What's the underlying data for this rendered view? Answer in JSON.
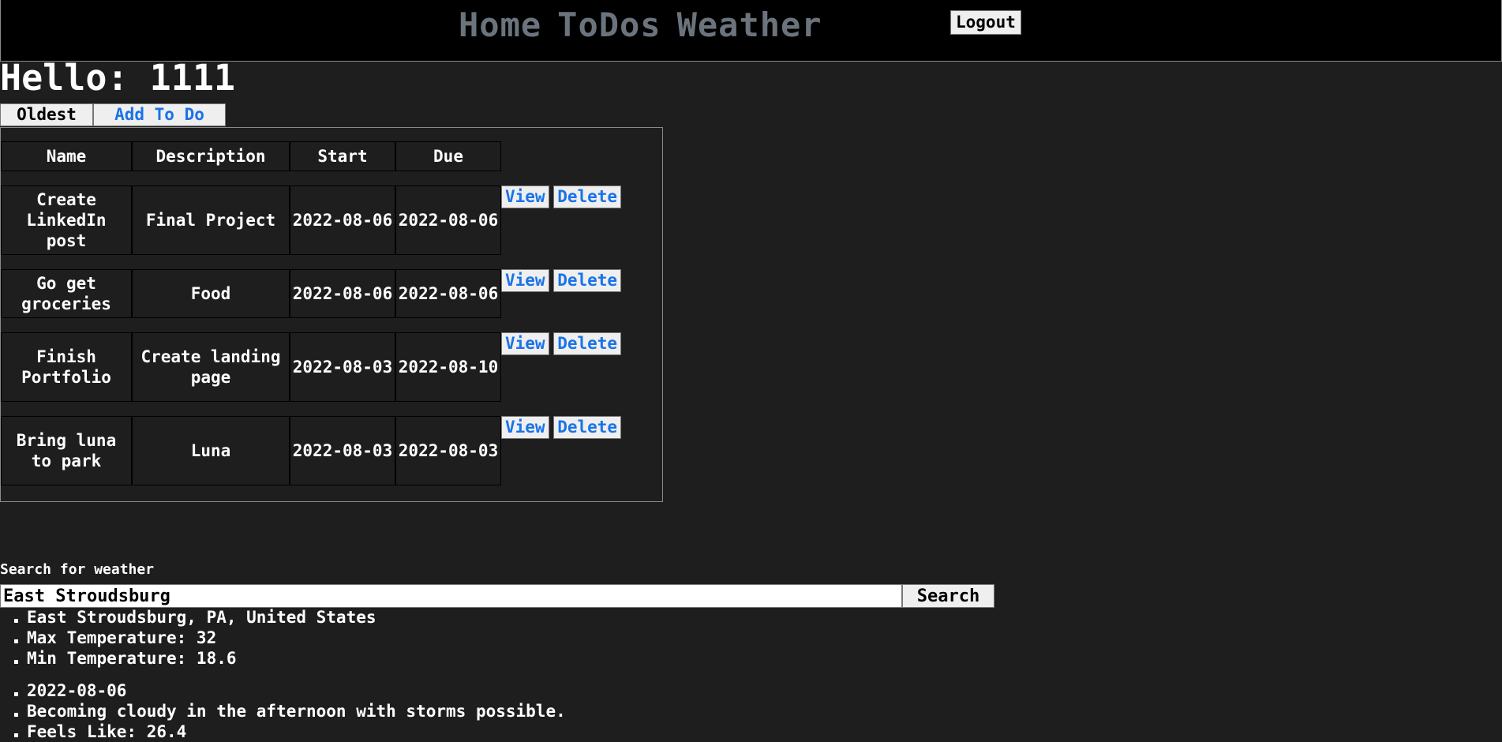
{
  "nav": {
    "links": [
      "Home",
      "ToDos",
      "Weather"
    ],
    "logout_label": "Logout"
  },
  "greeting": "Hello: 1111",
  "todo_controls": {
    "sort_label": "Oldest",
    "add_label": "Add To Do"
  },
  "todos": {
    "headers": [
      "Name",
      "Description",
      "Start",
      "Due"
    ],
    "view_label": "View",
    "delete_label": "Delete",
    "rows": [
      {
        "name": "Create LinkedIn post",
        "description": "Final Project",
        "start": "2022-08-06",
        "due": "2022-08-06"
      },
      {
        "name": "Go get groceries",
        "description": "Food",
        "start": "2022-08-06",
        "due": "2022-08-06"
      },
      {
        "name": "Finish Portfolio",
        "description": "Create landing page",
        "start": "2022-08-03",
        "due": "2022-08-10"
      },
      {
        "name": "Bring luna to park",
        "description": "Luna",
        "start": "2022-08-03",
        "due": "2022-08-03"
      }
    ]
  },
  "weather": {
    "search_label": "Search for weather",
    "input_value": "East Stroudsburg",
    "search_button": "Search",
    "location": [
      "East Stroudsburg, PA, United States",
      "Max Temperature: 32",
      "Min Temperature: 18.6"
    ],
    "day": [
      "2022-08-06",
      "Becoming cloudy in the afternoon with storms possible.",
      "Feels Like: 26.4"
    ]
  },
  "colors": {
    "page_bg": "#1e1e1e",
    "topbar_bg": "#000000",
    "nav_link": "#6b747d",
    "link_blue": "#1a73e8",
    "button_bg": "#efefef"
  }
}
